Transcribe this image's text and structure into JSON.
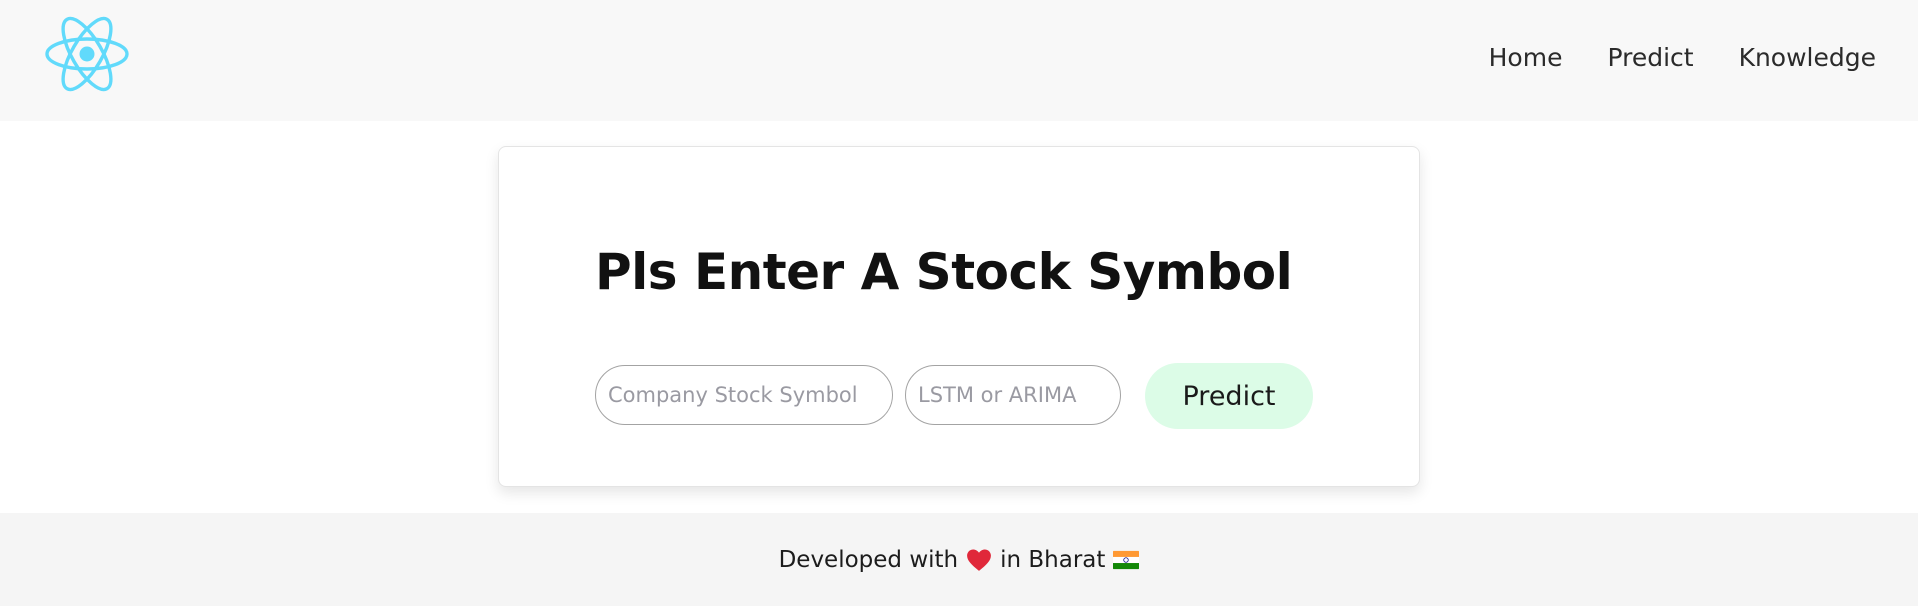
{
  "navbar": {
    "logo_icon": "react-atom-icon",
    "links": [
      {
        "label": "Home"
      },
      {
        "label": "Predict"
      },
      {
        "label": "Knowledge"
      }
    ]
  },
  "main": {
    "title": "Pls Enter A Stock Symbol",
    "symbol_placeholder": "Company Stock Symbol",
    "model_placeholder": "LSTM or ARIMA",
    "predict_label": "Predict"
  },
  "footer": {
    "prefix": "Developed with",
    "suffix": "in Bharat",
    "heart_icon": "red-heart-icon",
    "flag_icon": "india-flag-icon"
  },
  "colors": {
    "navbar_bg": "#f8f8f8",
    "logo": "#61dafb",
    "button_bg": "#dcfce7",
    "footer_bg": "#f5f5f5"
  }
}
